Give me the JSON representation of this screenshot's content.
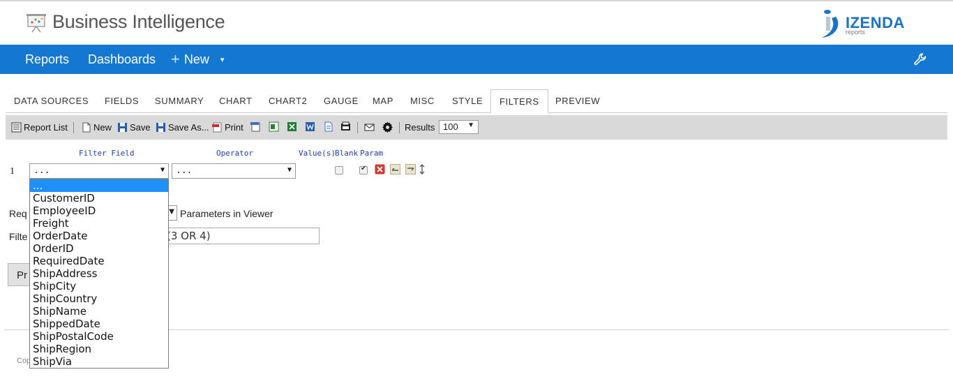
{
  "header": {
    "title": "Business Intelligence",
    "logo_text": "IZENDA",
    "logo_sub": "reports"
  },
  "nav": {
    "reports": "Reports",
    "dashboards": "Dashboards",
    "new": "New",
    "plus": "+",
    "caret": "▾"
  },
  "tabs": [
    "DATA SOURCES",
    "FIELDS",
    "SUMMARY",
    "CHART",
    "CHART2",
    "GAUGE",
    "MAP",
    "MISC",
    "STYLE",
    "FILTERS",
    "PREVIEW"
  ],
  "active_tab": "FILTERS",
  "toolbar": {
    "report_list": "Report List",
    "new": "New",
    "save": "Save",
    "save_as": "Save As...",
    "print": "Print",
    "results_label": "Results",
    "results_value": "100",
    "arrow": "▼"
  },
  "filters": {
    "headers": {
      "field": "Filter Field",
      "operator": "Operator",
      "values": "Value(s)",
      "blank": "Blank",
      "param": "Param"
    },
    "row": {
      "number": "1",
      "field_value": "...",
      "operator_value": "...",
      "blank_checked": false,
      "param_checked": true
    },
    "dropdown_options": [
      "...",
      "CustomerID",
      "EmployeeID",
      "Freight",
      "OrderDate",
      "OrderID",
      "RequiredDate",
      "ShipAddress",
      "ShipCity",
      "ShipCountry",
      "ShipName",
      "ShippedDate",
      "ShipPostalCode",
      "ShipRegion",
      "ShipVia"
    ]
  },
  "lower": {
    "require_label": "Req",
    "params_label": "Parameters in Viewer",
    "filter_logic_label": "Filte",
    "filter_logic_value": "(3 OR 4)",
    "preview_button": "Pr",
    "copyright": "Cop"
  },
  "colors": {
    "navbar": "#1478d2",
    "toolbar": "#d9d9d9",
    "dropdown_selected": "#1e90ff",
    "header_link": "#1c3fae",
    "logo": "#1a73c8"
  }
}
